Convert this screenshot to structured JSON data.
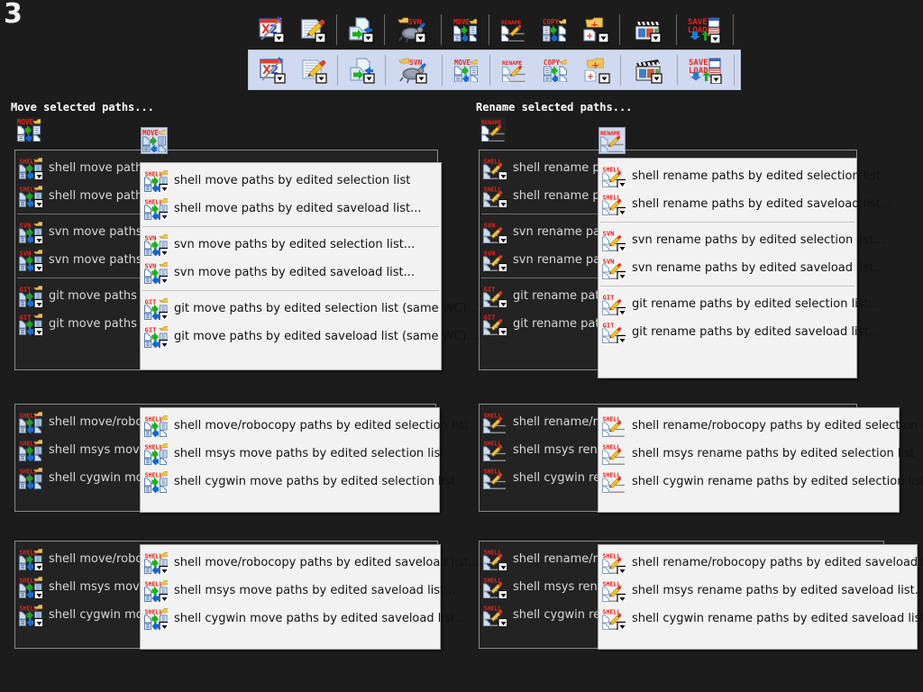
{
  "window": {
    "page_number": "3",
    "background_color": "#1c1c1c",
    "highlight_color": "#cfd9ef",
    "menu_light_bg": "#f2f2f2",
    "menu_dark_bg": "#232323"
  },
  "toolbar": {
    "rows": [
      {
        "state": "normal"
      },
      {
        "state": "highlighted"
      }
    ],
    "buttons": [
      {
        "name": "xy2-close-button",
        "icon": "xy2-window-icon",
        "label": "X·2",
        "has_dropdown": true
      },
      {
        "name": "edit-button",
        "icon": "notepad-pencil-icon",
        "label": "",
        "has_dropdown": true
      },
      {
        "name": "move-copy-button",
        "icon": "page-arrow-icon",
        "label": "",
        "has_dropdown": true
      },
      {
        "name": "svn-button",
        "icon": "tortoise-svn-icon",
        "label": "SVN",
        "has_dropdown": true
      },
      {
        "name": "move-button",
        "icon": "move-paths-icon",
        "label": "MOVE",
        "has_dropdown": true
      },
      {
        "name": "rename-button",
        "icon": "rename-paths-icon",
        "label": "RENAME",
        "has_dropdown": true
      },
      {
        "name": "copy-button",
        "icon": "copy-paths-icon",
        "label": "COPY",
        "has_dropdown": true
      },
      {
        "name": "new-folder-button",
        "icon": "new-folder-plus-icon",
        "label": "",
        "has_dropdown": true
      },
      {
        "name": "media-button",
        "icon": "film-clapper-icon",
        "label": "",
        "has_dropdown": true
      },
      {
        "name": "save-load-button",
        "icon": "save-load-icon",
        "label": "SAVE\nLOAD",
        "has_dropdown": true
      }
    ]
  },
  "sections": [
    {
      "id": "move-selected-paths",
      "title": "Move selected paths...",
      "tab_icon": "move-paths-icon",
      "tab_label": "MOVE",
      "background_menu": {
        "name": "move-background-menu",
        "groups": [
          [
            {
              "tag": "SHELL",
              "icon": "move-paths-icon",
              "label": "shell move paths by edited selection list",
              "has_dropdown": true
            },
            {
              "tag": "SHELL",
              "icon": "move-paths-icon",
              "label": "shell move paths by edited saveload list...",
              "has_dropdown": true
            }
          ],
          [
            {
              "tag": "SVN",
              "icon": "move-paths-icon",
              "label": "svn move paths by edited selection list...",
              "has_dropdown": true
            },
            {
              "tag": "SVN",
              "icon": "move-paths-icon",
              "label": "svn move paths by edited saveload list...",
              "has_dropdown": true
            }
          ],
          [
            {
              "tag": "GIT",
              "icon": "move-paths-icon",
              "label": "git move paths by edited selection list (same WC)...",
              "has_dropdown": true
            },
            {
              "tag": "GIT",
              "icon": "move-paths-icon",
              "label": "git move paths by edited saveload list (same WC)...",
              "has_dropdown": true
            }
          ]
        ]
      },
      "foreground_menu": {
        "name": "move-foreground-menu",
        "groups": [
          [
            {
              "tag": "SHELL",
              "icon": "move-paths-icon",
              "label": "shell move paths by edited selection list",
              "has_dropdown": true
            },
            {
              "tag": "SHELL",
              "icon": "move-paths-icon",
              "label": "shell move paths by edited saveload list...",
              "has_dropdown": true
            }
          ],
          [
            {
              "tag": "SVN",
              "icon": "move-paths-icon",
              "label": "svn move paths by edited selection list...",
              "has_dropdown": true
            },
            {
              "tag": "SVN",
              "icon": "move-paths-icon",
              "label": "svn move paths by edited saveload list...",
              "has_dropdown": true
            }
          ],
          [
            {
              "tag": "GIT",
              "icon": "move-paths-icon",
              "label": "git move paths by edited selection list (same WC)...",
              "has_dropdown": true
            },
            {
              "tag": "GIT",
              "icon": "move-paths-icon",
              "label": "git move paths by edited saveload list (same WC)...",
              "has_dropdown": true
            }
          ]
        ]
      }
    },
    {
      "id": "rename-selected-paths",
      "title": "Rename selected paths...",
      "tab_icon": "rename-paths-icon",
      "tab_label": "RENAME",
      "background_menu": {
        "name": "rename-background-menu",
        "groups": [
          [
            {
              "tag": "SHELL",
              "icon": "rename-paths-icon",
              "label": "shell rename paths by edited selection list",
              "has_dropdown": true
            },
            {
              "tag": "SHELL",
              "icon": "rename-paths-icon",
              "label": "shell rename paths by edited saveload list...",
              "has_dropdown": true
            }
          ],
          [
            {
              "tag": "SVN",
              "icon": "rename-paths-icon",
              "label": "svn rename paths by edited selection list...",
              "has_dropdown": true
            },
            {
              "tag": "SVN",
              "icon": "rename-paths-icon",
              "label": "svn rename paths by edited saveload list...",
              "has_dropdown": true
            }
          ],
          [
            {
              "tag": "GIT",
              "icon": "rename-paths-icon",
              "label": "git rename paths by edited selection list...",
              "has_dropdown": true
            },
            {
              "tag": "GIT",
              "icon": "rename-paths-icon",
              "label": "git rename paths by edited saveload list...",
              "has_dropdown": true
            }
          ]
        ]
      },
      "foreground_menu": {
        "name": "rename-foreground-menu",
        "groups": [
          [
            {
              "tag": "SHELL",
              "icon": "rename-paths-icon",
              "label": "shell rename paths by edited selection list",
              "has_dropdown": true
            },
            {
              "tag": "SHELL",
              "icon": "rename-paths-icon",
              "label": "shell rename paths by edited saveload list...",
              "has_dropdown": true
            }
          ],
          [
            {
              "tag": "SVN",
              "icon": "rename-paths-icon",
              "label": "svn rename paths by edited selection list...",
              "has_dropdown": true
            },
            {
              "tag": "SVN",
              "icon": "rename-paths-icon",
              "label": "svn rename paths by edited saveload list...",
              "has_dropdown": true
            }
          ],
          [
            {
              "tag": "GIT",
              "icon": "rename-paths-icon",
              "label": "git rename paths by edited selection list...",
              "has_dropdown": true
            },
            {
              "tag": "GIT",
              "icon": "rename-paths-icon",
              "label": "git rename paths by edited saveload list...",
              "has_dropdown": true
            }
          ]
        ]
      }
    },
    {
      "id": "move-robocopy-selection",
      "title": "",
      "background_menu": {
        "name": "move-robocopy-selection-background-menu",
        "groups": [
          [
            {
              "tag": "SHELL",
              "icon": "move-paths-icon",
              "label": "shell move/robocopy paths by edited selection list",
              "has_dropdown": false
            },
            {
              "tag": "SHELL",
              "icon": "move-paths-icon",
              "label": "shell msys move paths by edited selection list",
              "has_dropdown": false
            },
            {
              "tag": "SHELL",
              "icon": "move-paths-icon",
              "label": "shell cygwin move paths by edited selection list",
              "has_dropdown": false
            }
          ]
        ]
      },
      "foreground_menu": {
        "name": "move-robocopy-selection-foreground-menu",
        "groups": [
          [
            {
              "tag": "SHELL",
              "icon": "move-paths-icon",
              "label": "shell move/robocopy paths by edited selection list",
              "has_dropdown": false
            },
            {
              "tag": "SHELL",
              "icon": "move-paths-icon",
              "label": "shell msys move paths by edited selection list",
              "has_dropdown": false
            },
            {
              "tag": "SHELL",
              "icon": "move-paths-icon",
              "label": "shell cygwin move paths by edited selection list",
              "has_dropdown": false
            }
          ]
        ]
      }
    },
    {
      "id": "rename-robocopy-selection",
      "title": "",
      "background_menu": {
        "name": "rename-robocopy-selection-background-menu",
        "groups": [
          [
            {
              "tag": "SHELL",
              "icon": "rename-paths-icon",
              "label": "shell rename/robocopy paths by edited selection list",
              "has_dropdown": false
            },
            {
              "tag": "SHELL",
              "icon": "rename-paths-icon",
              "label": "shell msys rename paths by edited selection list",
              "has_dropdown": false
            },
            {
              "tag": "SHELL",
              "icon": "rename-paths-icon",
              "label": "shell cygwin rename paths by edited selection list",
              "has_dropdown": false
            }
          ]
        ]
      },
      "foreground_menu": {
        "name": "rename-robocopy-selection-foreground-menu",
        "groups": [
          [
            {
              "tag": "SHELL",
              "icon": "rename-paths-icon",
              "label": "shell rename/robocopy paths by edited selection list",
              "has_dropdown": false
            },
            {
              "tag": "SHELL",
              "icon": "rename-paths-icon",
              "label": "shell msys rename paths by edited selection list",
              "has_dropdown": false
            },
            {
              "tag": "SHELL",
              "icon": "rename-paths-icon",
              "label": "shell cygwin rename paths by edited selection list",
              "has_dropdown": false
            }
          ]
        ]
      }
    },
    {
      "id": "move-robocopy-saveload",
      "title": "",
      "background_menu": {
        "name": "move-robocopy-saveload-background-menu",
        "groups": [
          [
            {
              "tag": "SHELL",
              "icon": "move-paths-icon",
              "label": "shell move/robocopy paths by edited saveload list...",
              "has_dropdown": true
            },
            {
              "tag": "SHELL",
              "icon": "move-paths-icon",
              "label": "shell msys move paths by edited saveload list...",
              "has_dropdown": true
            },
            {
              "tag": "SHELL",
              "icon": "move-paths-icon",
              "label": "shell cygwin move paths by edited saveload list...",
              "has_dropdown": true
            }
          ]
        ]
      },
      "foreground_menu": {
        "name": "move-robocopy-saveload-foreground-menu",
        "groups": [
          [
            {
              "tag": "SHELL",
              "icon": "move-paths-icon",
              "label": "shell move/robocopy paths by edited saveload list...",
              "has_dropdown": true
            },
            {
              "tag": "SHELL",
              "icon": "move-paths-icon",
              "label": "shell msys move paths by edited saveload list...",
              "has_dropdown": true
            },
            {
              "tag": "SHELL",
              "icon": "move-paths-icon",
              "label": "shell cygwin move paths by edited saveload list...",
              "has_dropdown": true
            }
          ]
        ]
      }
    },
    {
      "id": "rename-robocopy-saveload",
      "title": "",
      "background_menu": {
        "name": "rename-robocopy-saveload-background-menu",
        "groups": [
          [
            {
              "tag": "SHELL",
              "icon": "rename-paths-icon",
              "label": "shell rename/robocopy paths by edited saveload list...",
              "has_dropdown": true
            },
            {
              "tag": "SHELL",
              "icon": "rename-paths-icon",
              "label": "shell msys rename paths by edited saveload list...",
              "has_dropdown": true
            },
            {
              "tag": "SHELL",
              "icon": "rename-paths-icon",
              "label": "shell cygwin rename paths by edited saveload list...",
              "has_dropdown": true
            }
          ]
        ]
      },
      "foreground_menu": {
        "name": "rename-robocopy-saveload-foreground-menu",
        "groups": [
          [
            {
              "tag": "SHELL",
              "icon": "rename-paths-icon",
              "label": "shell rename/robocopy paths by edited saveload list...",
              "has_dropdown": true
            },
            {
              "tag": "SHELL",
              "icon": "rename-paths-icon",
              "label": "shell msys rename paths by edited saveload list...",
              "has_dropdown": true
            },
            {
              "tag": "SHELL",
              "icon": "rename-paths-icon",
              "label": "shell cygwin rename paths by edited saveload list...",
              "has_dropdown": true
            }
          ]
        ]
      }
    }
  ]
}
